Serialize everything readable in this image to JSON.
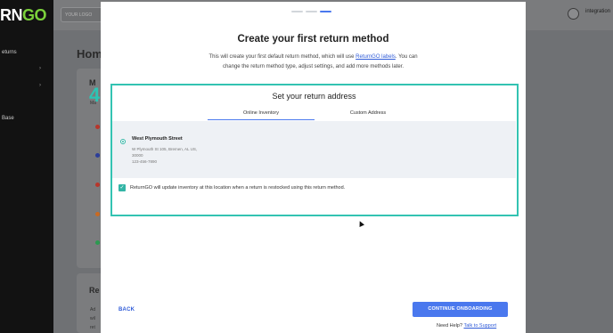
{
  "app": {
    "brand_prefix": "RN",
    "brand_suffix": "GO",
    "logo_placeholder": "YOUR LOGO",
    "user_label": "integration",
    "sidebar": {
      "items": [
        "eturns",
        "",
        "Base"
      ]
    },
    "bg_title": "Hom",
    "bg_card_heading": "M",
    "bg_card_sub": "Ma",
    "bg_section": "Re",
    "bg_lines": [
      "Ad",
      "wil",
      "ret"
    ],
    "bg_dot_colors": [
      "#b8362b",
      "#2c3e9a",
      "#b8362b",
      "#c96a22",
      "#2c9a50"
    ]
  },
  "step_marker": "4",
  "modal": {
    "progress": {
      "total": 3,
      "current": 3
    },
    "title": "Create your first return method",
    "subtitle_pre": "This will create your first default return method, which will use ",
    "subtitle_link": "ReturnGO labels",
    "subtitle_post": ". You can change the return method type, adjust settings, and add more methods later.",
    "address_section": {
      "title": "Set your return address",
      "tabs": [
        {
          "label": "Online Inventory",
          "active": true
        },
        {
          "label": "Custom Address",
          "active": false
        }
      ],
      "selected_location": {
        "name": "West Plymouth Street",
        "lines": [
          "W Plymouth St 105, Bremen, AL US,",
          "30000",
          "123-456-7890"
        ]
      },
      "checkbox_label": "ReturnGO will update inventory at this location when a return is restocked using this return method.",
      "checkbox_checked": true
    },
    "back_label": "BACK",
    "continue_label": "CONTINUE ONBOARDING",
    "help_text": "Need Help?",
    "help_link": "Talk to Support"
  },
  "colors": {
    "accent": "#4a78ee",
    "teal": "#33c3b2",
    "brand_green": "#7bd13b"
  }
}
